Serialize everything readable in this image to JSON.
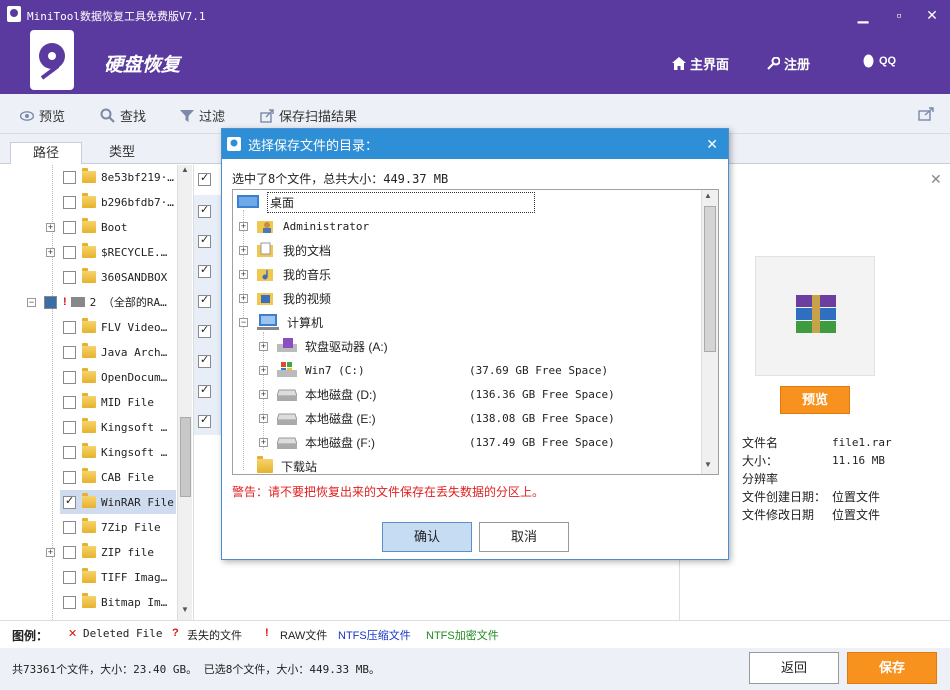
{
  "app": {
    "title": "MiniTool数据恢复工具免费版V7.1",
    "name": "硬盘恢复",
    "nav": {
      "home": "主界面",
      "register": "注册",
      "qq": "QQ"
    }
  },
  "toolbar": {
    "preview": "预览",
    "find": "查找",
    "filter": "过滤",
    "save_scan": "保存扫描结果"
  },
  "tabs": [
    {
      "label": "路径"
    },
    {
      "label": "类型"
    }
  ],
  "tree": {
    "items": [
      {
        "label": "8e53bf219·…",
        "checked": false
      },
      {
        "label": "b296bfdb7·…",
        "checked": false
      },
      {
        "label": "Boot",
        "checked": false
      },
      {
        "label": "$RECYCLE.…",
        "checked": false
      },
      {
        "label": "360SANDBOX",
        "checked": false
      },
      {
        "label": "2 （全部的RA…",
        "checked": false
      },
      {
        "label": "FLV Video…",
        "checked": false
      },
      {
        "label": "Java Arch…",
        "checked": false
      },
      {
        "label": "OpenDocum…",
        "checked": false
      },
      {
        "label": "MID File",
        "checked": false
      },
      {
        "label": "Kingsoft …",
        "checked": false
      },
      {
        "label": "Kingsoft …",
        "checked": false
      },
      {
        "label": "CAB File",
        "checked": false
      },
      {
        "label": "WinRAR File",
        "checked": true
      },
      {
        "label": "7Zip File",
        "checked": false
      },
      {
        "label": "ZIP file",
        "checked": false
      },
      {
        "label": "TIFF Imag…",
        "checked": false
      },
      {
        "label": "Bitmap Im…",
        "checked": false
      }
    ]
  },
  "detail": {
    "preview_button": "预览",
    "fields": [
      {
        "label": "文件名",
        "value": "file1.rar"
      },
      {
        "label": "大小：",
        "value": "11.16 MB"
      },
      {
        "label": "分辨率",
        "value": ""
      },
      {
        "label": "文件创建日期：",
        "value": "位置文件"
      },
      {
        "label": "文件修改日期",
        "value": "位置文件"
      }
    ]
  },
  "legend": {
    "title": "图例：",
    "deleted": "Deleted File",
    "lost": "丢失的文件",
    "raw": "RAW文件",
    "ntfs_compressed": "NTFS压缩文件",
    "ntfs_encrypted": "NTFS加密文件"
  },
  "status": {
    "summary": "共73361个文件，大小：23.40 GB。 已选8个文件，大小：449.33 MB。",
    "back_button": "返回",
    "save_button": "保存"
  },
  "dialog": {
    "title": "选择保存文件的目录：",
    "selected_info": "选中了8个文件，总共大小：449.37 MB",
    "items": [
      {
        "label": "桌面",
        "space": ""
      },
      {
        "label": "Administrator",
        "space": ""
      },
      {
        "label": "我的文档",
        "space": ""
      },
      {
        "label": "我的音乐",
        "space": ""
      },
      {
        "label": "我的视频",
        "space": ""
      },
      {
        "label": "计算机",
        "space": ""
      },
      {
        "label": "软盘驱动器 (A:)",
        "space": ""
      },
      {
        "label": "Win7 (C:)",
        "space": "(37.69 GB Free Space)"
      },
      {
        "label": "本地磁盘 (D:)",
        "space": "(136.36 GB Free Space)"
      },
      {
        "label": "本地磁盘 (E:)",
        "space": "(138.08 GB Free Space)"
      },
      {
        "label": "本地磁盘 (F:)",
        "space": "(137.49 GB Free Space)"
      },
      {
        "label": "下载站",
        "space": ""
      }
    ],
    "warning": "警告：请不要把恢复出来的文件保存在丢失数据的分区上。",
    "ok_button": "确认",
    "cancel_button": "取消"
  },
  "colors": {
    "header": "#5a3a9e",
    "dialog_title": "#2e8fd6",
    "accent": "#f7921e",
    "warning": "#e02020"
  }
}
